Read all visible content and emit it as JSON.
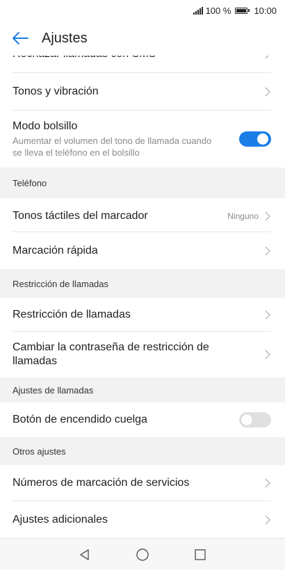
{
  "status": {
    "battery": "100 %",
    "time": "10:00"
  },
  "header": {
    "title": "Ajustes"
  },
  "rows": {
    "partial": "Rechazar llamadas con SMS",
    "tones": "Tonos y vibración",
    "pocket": {
      "label": "Modo bolsillo",
      "sub": "Aumentar el volumen del tono de llamada cuando se lleva el teléfono en el bolsillo",
      "enabled": true
    },
    "dialer_tones": {
      "label": "Tonos táctiles del marcador",
      "value": "Ninguno"
    },
    "speed_dial": "Marcación rápida",
    "barring": "Restricción de llamadas",
    "barring_pwd": "Cambiar la contraseña de restricción de llamadas",
    "power_end": {
      "label": "Botón de encendido cuelga",
      "enabled": false
    },
    "fdn": "Números de marcación de servicios",
    "additional": "Ajustes adicionales"
  },
  "sections": {
    "phone": "Teléfono",
    "barring": "Restricción de llamadas",
    "call_settings": "Ajustes de llamadas",
    "other": "Otros ajustes"
  },
  "colors": {
    "accent": "#1a7ee6"
  }
}
